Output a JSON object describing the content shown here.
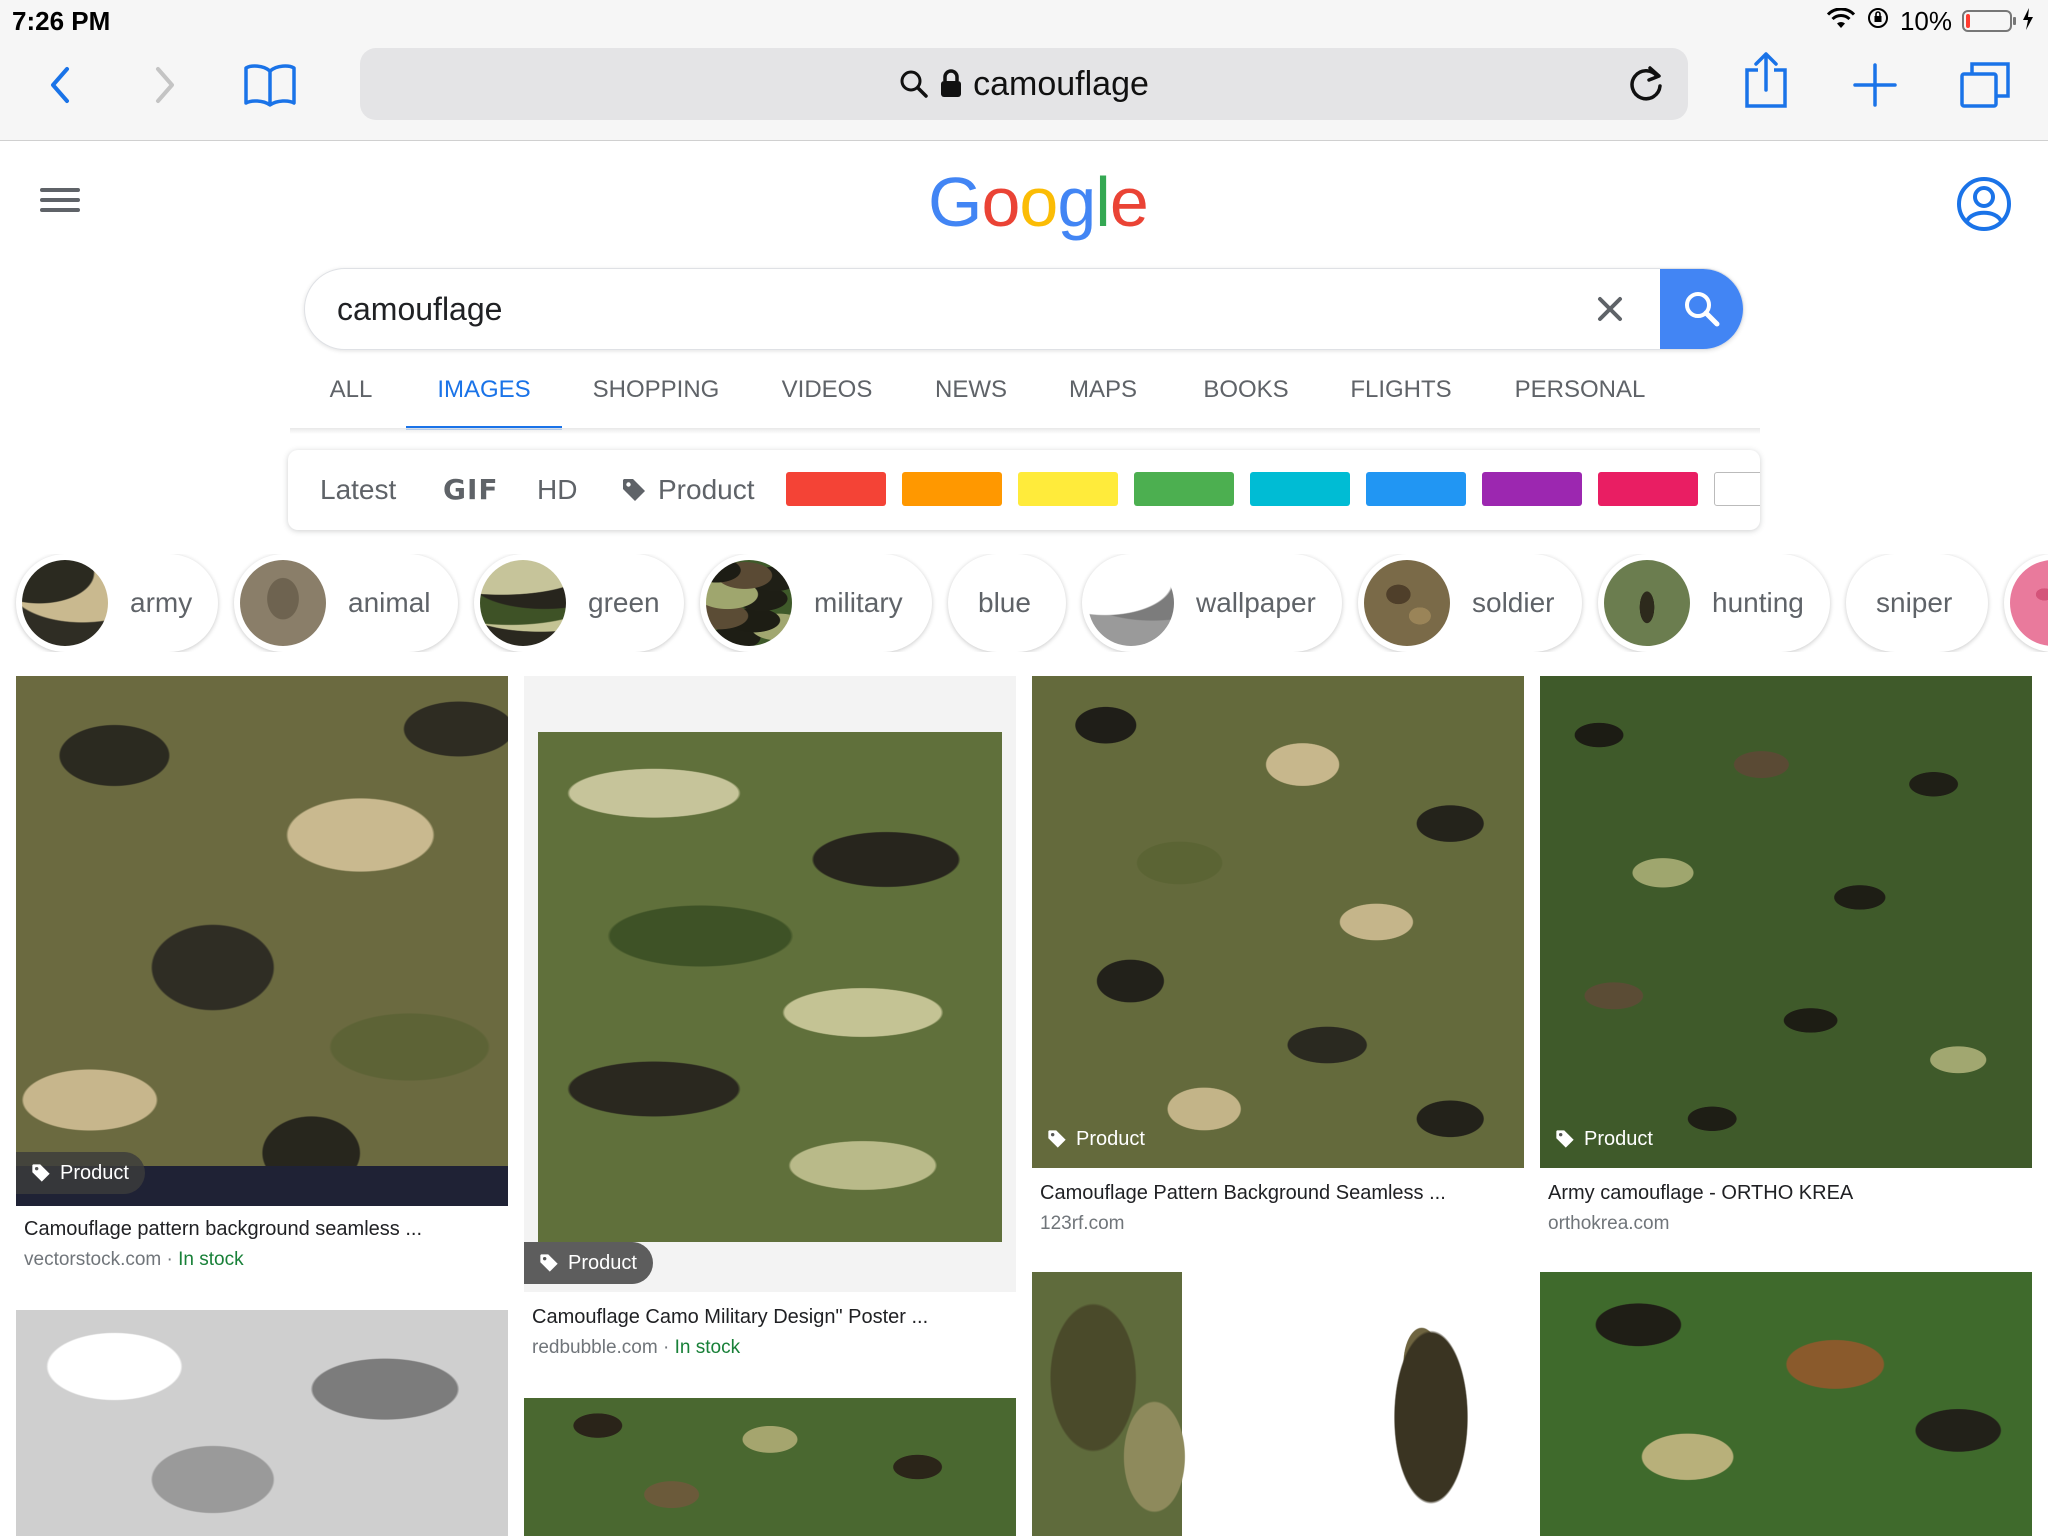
{
  "status_bar": {
    "time": "7:26 PM",
    "battery": "10%",
    "battery_level": 0.1
  },
  "browser": {
    "url_text": "camouflage"
  },
  "google": {
    "logo": [
      "G",
      "o",
      "o",
      "g",
      "l",
      "e"
    ],
    "logo_colors": [
      "#4285F4",
      "#EA4335",
      "#FBBC05",
      "#4285F4",
      "#34A853",
      "#EA4335"
    ],
    "search_query": "camouflage",
    "accent": "#1a73e8",
    "search_button_color": "#4285f4"
  },
  "tabs": [
    {
      "label": "ALL",
      "active": false
    },
    {
      "label": "IMAGES",
      "active": true
    },
    {
      "label": "SHOPPING",
      "active": false
    },
    {
      "label": "VIDEOS",
      "active": false
    },
    {
      "label": "NEWS",
      "active": false
    },
    {
      "label": "MAPS",
      "active": false
    },
    {
      "label": "BOOKS",
      "active": false
    },
    {
      "label": "FLIGHTS",
      "active": false
    },
    {
      "label": "PERSONAL",
      "active": false
    }
  ],
  "filters": {
    "latest": "Latest",
    "gif": "GIF",
    "hd": "HD",
    "product": "Product",
    "color_swatches": [
      "#f44336",
      "#ff9800",
      "#ffeb3b",
      "#4caf50",
      "#00bcd4",
      "#2196f3",
      "#9c27b0",
      "#e91e63",
      "#ffffff"
    ]
  },
  "related_chips": [
    {
      "label": "army"
    },
    {
      "label": "animal"
    },
    {
      "label": "green"
    },
    {
      "label": "military"
    },
    {
      "label": "blue"
    },
    {
      "label": "wallpaper"
    },
    {
      "label": "soldier"
    },
    {
      "label": "hunting"
    },
    {
      "label": "sniper"
    }
  ],
  "results": [
    {
      "badge": "Product",
      "title": "Camouflage pattern background seamless ...",
      "source": "vectorstock.com",
      "stock": "In stock"
    },
    {
      "badge": "Product",
      "title": "Camouflage Camo Military Design\" Poster ...",
      "source": "redbubble.com",
      "stock": "In stock"
    },
    {
      "badge": "Product",
      "title": "Camouflage Pattern Background Seamless ...",
      "source": "123rf.com"
    },
    {
      "badge": "Product",
      "title": "Army camouflage - ORTHO KREA",
      "source": "orthokrea.com"
    }
  ],
  "separator": "·"
}
